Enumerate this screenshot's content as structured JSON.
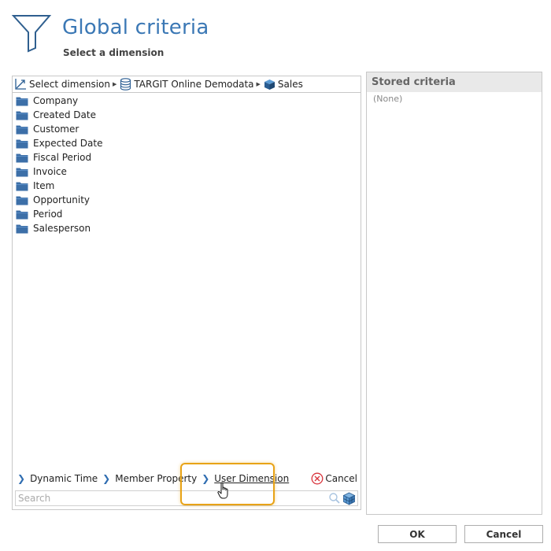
{
  "header": {
    "title": "Global criteria",
    "subtitle": "Select a dimension"
  },
  "breadcrumb": {
    "items": [
      "Select dimension",
      "TARGIT Online Demodata",
      "Sales"
    ]
  },
  "dimensions": [
    "Company",
    "Created Date",
    "Customer",
    "Expected Date",
    "Fiscal Period",
    "Invoice",
    "Item",
    "Opportunity",
    "Period",
    "Salesperson"
  ],
  "bottom_links": {
    "dynamic_time": "Dynamic Time",
    "member_property": "Member Property",
    "user_dimension": "User Dimension",
    "cancel": "Cancel"
  },
  "search": {
    "placeholder": "Search",
    "value": ""
  },
  "stored_criteria": {
    "header": "Stored criteria",
    "empty_text": "(None)"
  },
  "buttons": {
    "ok": "OK",
    "cancel": "Cancel"
  },
  "colors": {
    "accent": "#3b78b5",
    "highlight": "#e8a317",
    "folder": "#3c6fa8",
    "cancel_icon": "#d9363e"
  },
  "icons": [
    "funnel-icon",
    "select-dimension-icon",
    "database-icon",
    "cube-icon",
    "folder-icon",
    "chevron-right-icon",
    "cancel-icon",
    "search-icon",
    "cube-search-icon",
    "hand-cursor-icon"
  ]
}
